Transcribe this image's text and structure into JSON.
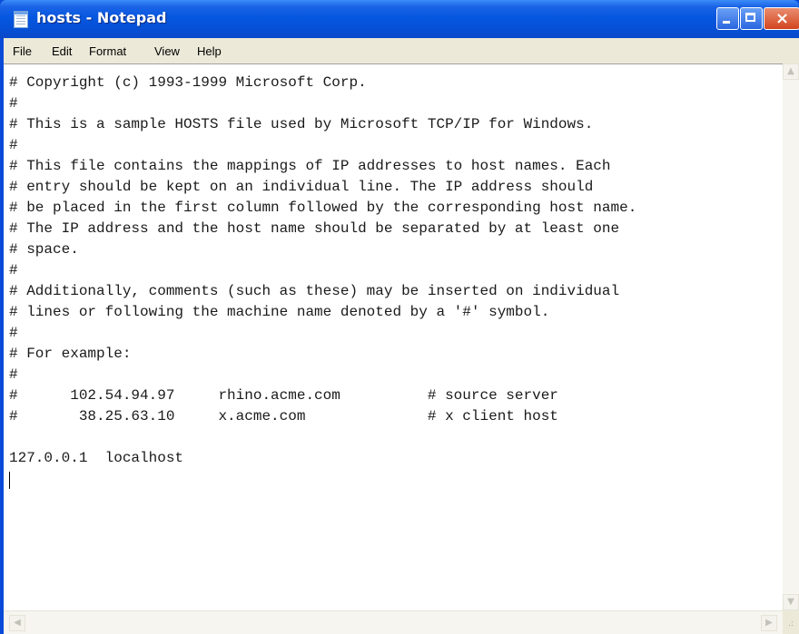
{
  "window": {
    "title": "hosts - Notepad",
    "app_icon": "notepad-icon"
  },
  "titlebar_buttons": {
    "minimize": "minimize-icon",
    "maximize": "maximize-icon",
    "close_glyph": "×"
  },
  "menubar": {
    "items": [
      "File",
      "Edit",
      "Format",
      "View",
      "Help"
    ]
  },
  "editor": {
    "lines": [
      "# Copyright (c) 1993-1999 Microsoft Corp.",
      "#",
      "# This is a sample HOSTS file used by Microsoft TCP/IP for Windows.",
      "#",
      "# This file contains the mappings of IP addresses to host names. Each",
      "# entry should be kept on an individual line. The IP address should",
      "# be placed in the first column followed by the corresponding host name.",
      "# The IP address and the host name should be separated by at least one",
      "# space.",
      "#",
      "# Additionally, comments (such as these) may be inserted on individual",
      "# lines or following the machine name denoted by a '#' symbol.",
      "#",
      "# For example:",
      "#",
      "#      102.54.94.97     rhino.acme.com          # source server",
      "#       38.25.63.10     x.acme.com              # x client host",
      "",
      "127.0.0.1  localhost"
    ]
  },
  "scrollbars": {
    "up_arrow": "▲",
    "down_arrow": "▼",
    "left_arrow": "◀",
    "right_arrow": "▶",
    "grip": ".:"
  },
  "colors": {
    "titlebar": "#0550d6",
    "menubar": "#ece9d8",
    "editor_bg": "#ffffff"
  }
}
